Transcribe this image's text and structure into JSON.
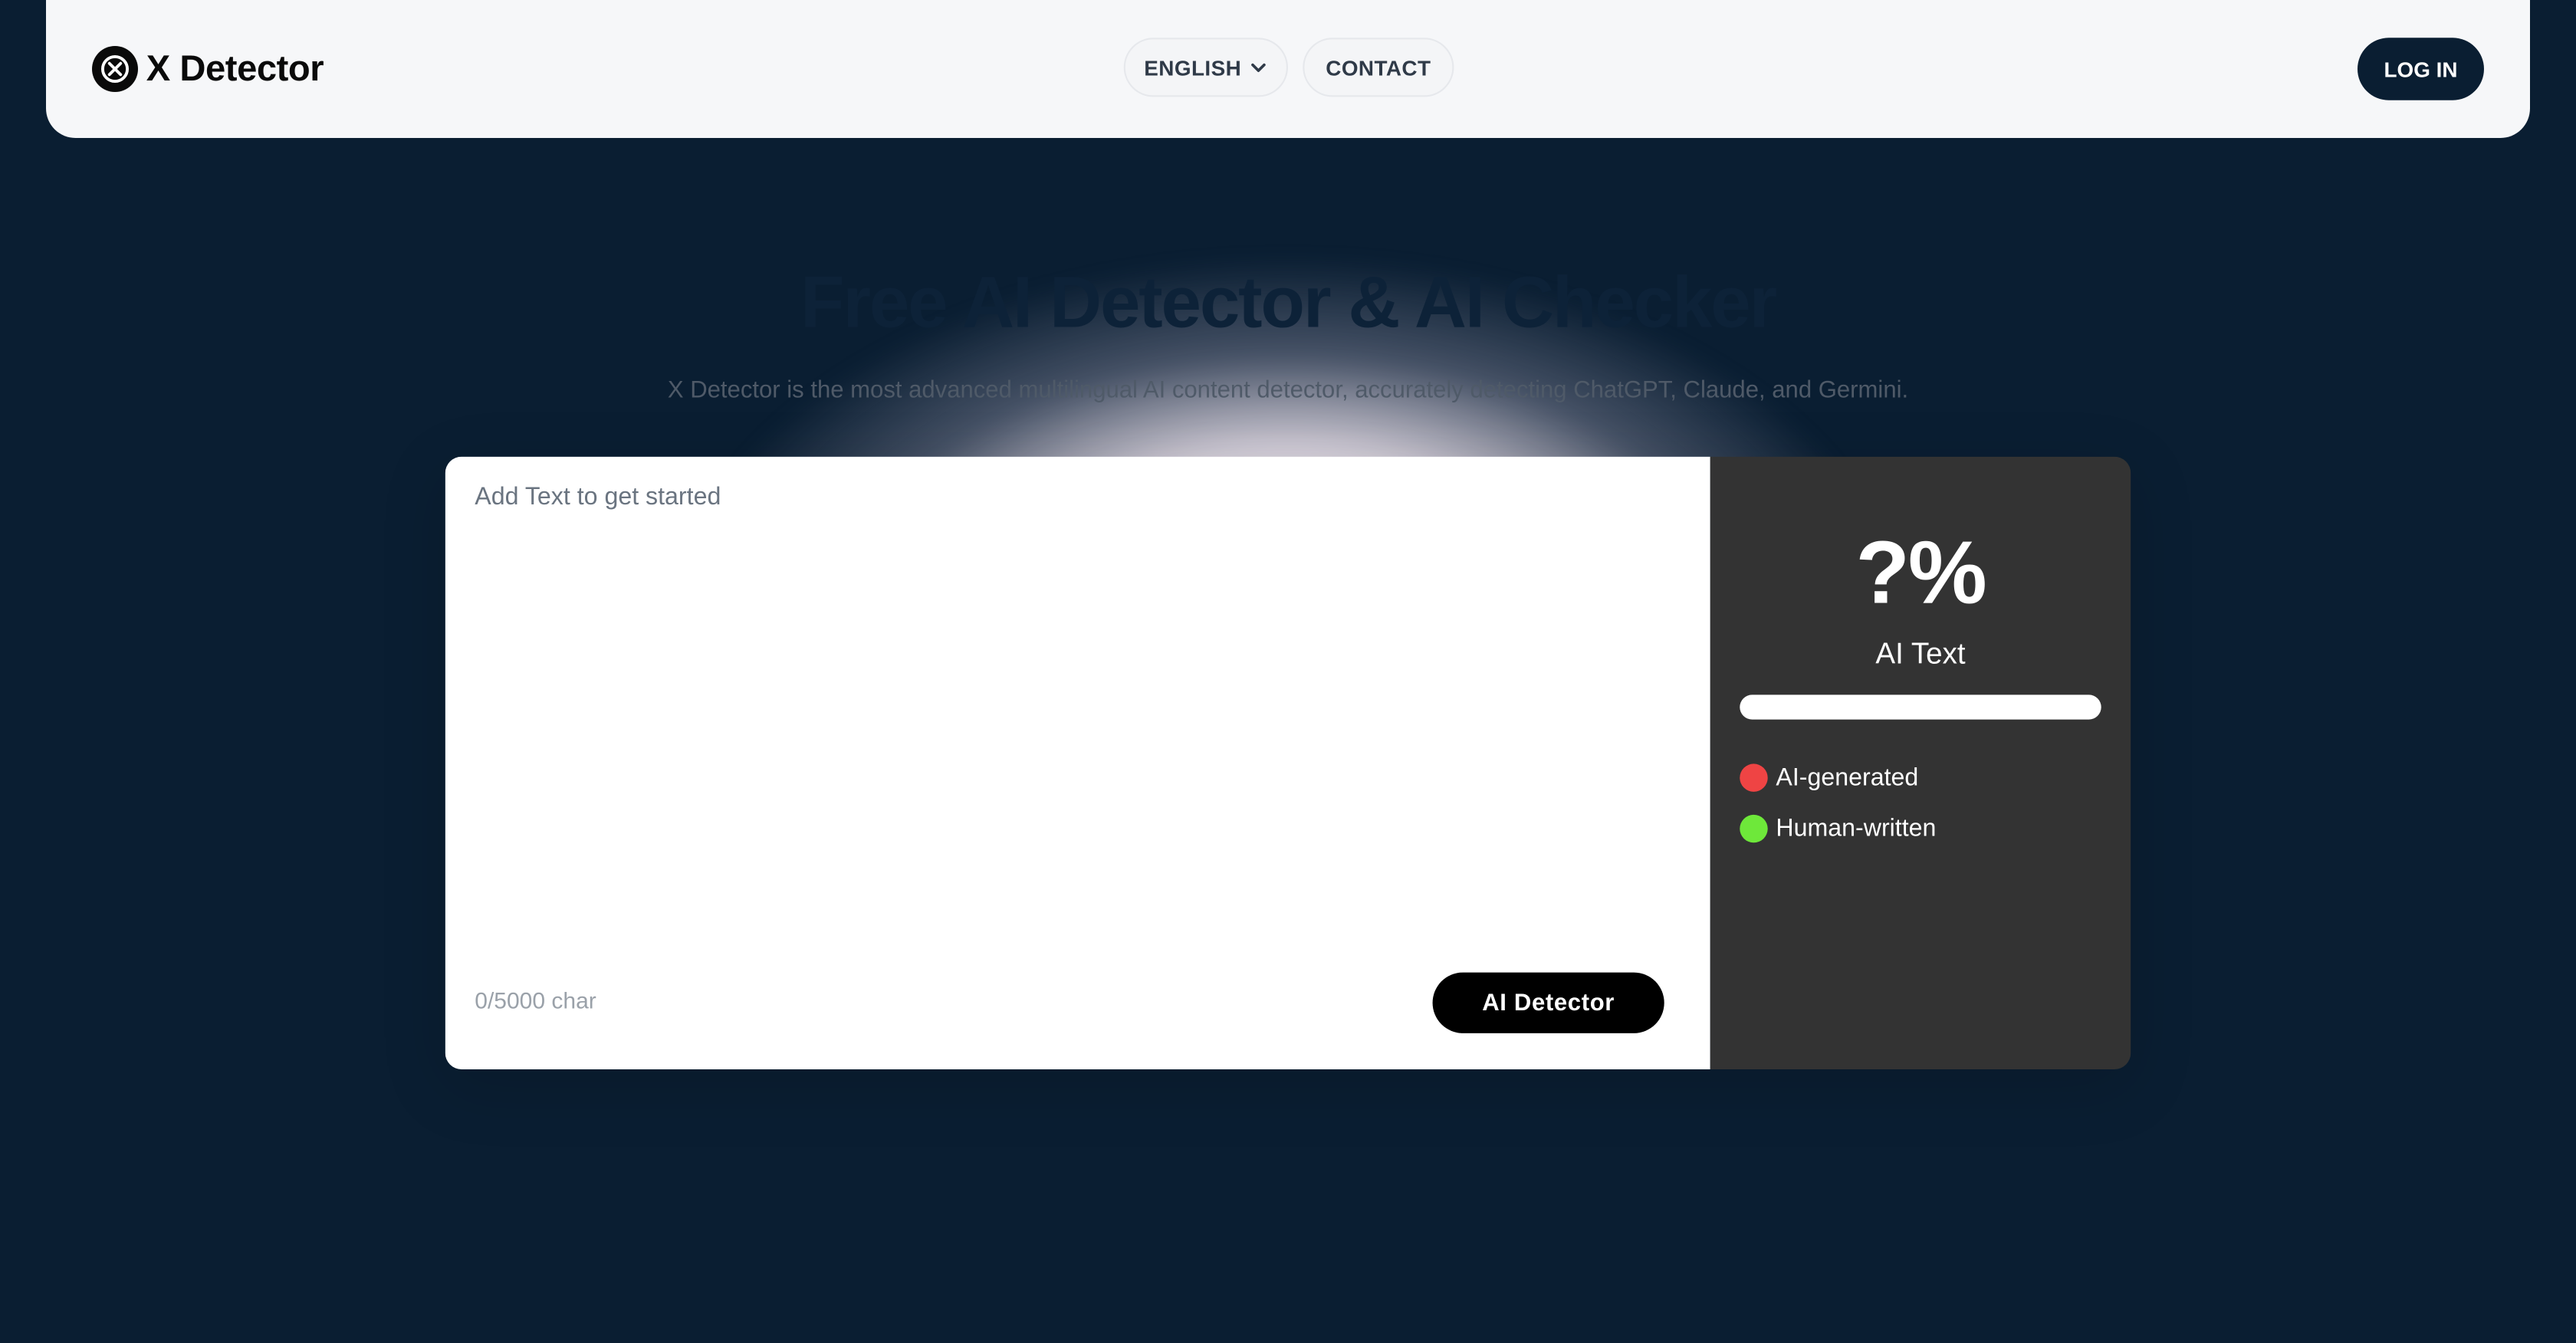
{
  "header": {
    "logo_text": "X Detector",
    "nav": {
      "language_label": "ENGLISH",
      "contact_label": "CONTACT"
    },
    "login_label": "LOG IN"
  },
  "hero": {
    "title": "Free AI Detector & AI Checker",
    "subtitle": "X Detector is the most advanced multilingual AI content detector, accurately detecting ChatGPT, Claude, and Germini."
  },
  "editor": {
    "placeholder": "Add Text to get started",
    "value": "",
    "char_count": "0/5000 char",
    "detect_button_label": "AI Detector"
  },
  "result": {
    "percent_display": "?%",
    "label": "AI Text",
    "ai_fraction": 0,
    "legend": [
      {
        "label": "AI-generated",
        "color": "#ef4444"
      },
      {
        "label": "Human-written",
        "color": "#6ee83a"
      }
    ]
  },
  "colors": {
    "background": "#0a1e32",
    "header_bg": "#f6f7f9",
    "login_bg": "#0a1e32",
    "result_panel_bg": "#333333",
    "detect_button_bg": "#000000"
  },
  "icons": {
    "logo": "x-circle-icon",
    "language_dropdown": "chevron-down-icon"
  }
}
